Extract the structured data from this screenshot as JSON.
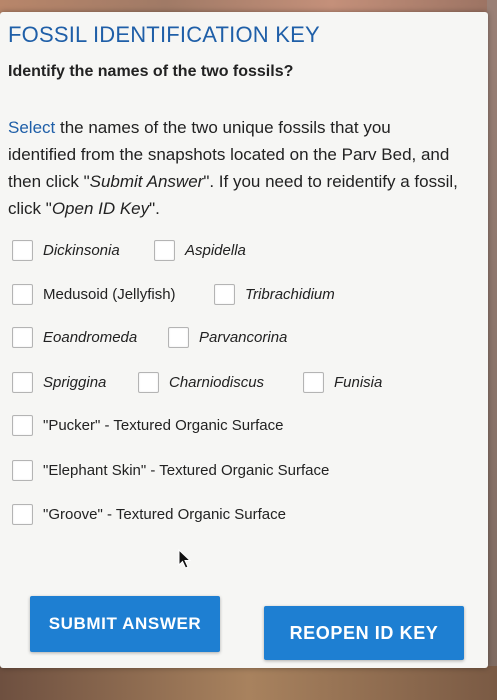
{
  "header": {
    "title": "FOSSIL IDENTIFICATION KEY",
    "question": "Identify the names of the two fossils?"
  },
  "instructions": {
    "select_word": "Select",
    "text_1": " the names of the two unique fossils that you identified from the snapshots located on the Parv Bed, and then click \"",
    "submit_ref": "Submit Answer",
    "text_2": "\". If you need to reidentify a fossil, click \"",
    "open_ref": "Open ID Key",
    "text_3": "\"."
  },
  "options": {
    "dickinsonia": "Dickinsonia",
    "aspidella": "Aspidella",
    "medusoid": "Medusoid (Jellyfish)",
    "tribrachidium": "Tribrachidium",
    "eoandromeda": "Eoandromeda",
    "parvancorina": "Parvancorina",
    "spriggina": "Spriggina",
    "charniodiscus": "Charniodiscus",
    "funisia": "Funisia",
    "pucker": "\"Pucker\" - Textured Organic Surface",
    "elephant_skin": "\"Elephant Skin\" - Textured Organic Surface",
    "groove": "\"Groove\" - Textured Organic Surface"
  },
  "buttons": {
    "submit_label": "SUBMIT ANSWER",
    "reopen_label": "REOPEN ID KEY"
  },
  "colors": {
    "title": "#1f5fa8",
    "button": "#1e7fd2"
  },
  "icons": {
    "cursor": "mouse-pointer-icon"
  }
}
